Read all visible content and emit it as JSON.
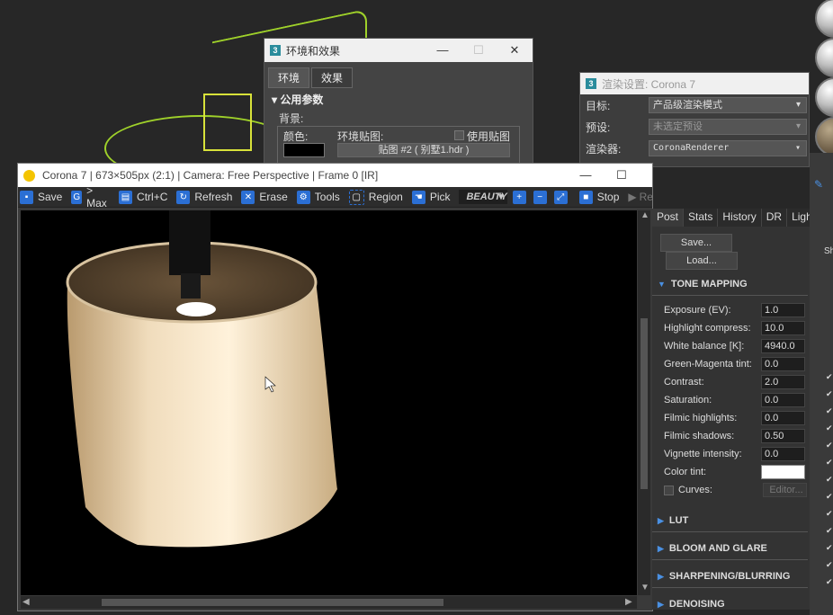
{
  "env_window": {
    "title": "环境和效果",
    "tabs": [
      "环境",
      "效果"
    ],
    "rollout": "公用参数",
    "group_label": "背景:",
    "color_label": "颜色:",
    "map_label": "环境贴图:",
    "use_map_label": "使用贴图",
    "map_button": "贴图 #2 ( 别墅1.hdr )"
  },
  "render_settings": {
    "title": "渲染设置: Corona 7",
    "rows": [
      {
        "label": "目标:",
        "value": "产品级渲染模式"
      },
      {
        "label": "预设:",
        "value": "未选定预设"
      },
      {
        "label": "渲染器:",
        "value": "CoronaRenderer"
      }
    ]
  },
  "vfb": {
    "title": "Corona 7 | 673×505px (2:1) | Camera: Free Perspective | Frame 0 [IR]",
    "toolbar": {
      "save": "Save",
      "max": "> Max",
      "copy": "Ctrl+C",
      "refresh": "Refresh",
      "erase": "Erase",
      "tools": "Tools",
      "region": "Region",
      "pick": "Pick",
      "channel": "BEAUTY",
      "stop": "Stop",
      "render": "Re"
    }
  },
  "post_panel": {
    "tabs": [
      "Post",
      "Stats",
      "History",
      "DR",
      "Ligh"
    ],
    "save_button": "Save...",
    "load_button": "Load...",
    "tone_mapping": "TONE MAPPING",
    "params": [
      {
        "label": "Exposure (EV):",
        "value": "1.0"
      },
      {
        "label": "Highlight compress:",
        "value": "10.0"
      },
      {
        "label": "White balance [K]:",
        "value": "4940.0"
      },
      {
        "label": "Green-Magenta tint:",
        "value": "0.0"
      },
      {
        "label": "Contrast:",
        "value": "2.0"
      },
      {
        "label": "Saturation:",
        "value": "0.0"
      },
      {
        "label": "Filmic highlights:",
        "value": "0.0"
      },
      {
        "label": "Filmic shadows:",
        "value": "0.50"
      },
      {
        "label": "Vignette intensity:",
        "value": "0.0"
      }
    ],
    "color_tint_label": "Color tint:",
    "curves_label": "Curves:",
    "editor_button": "Editor...",
    "sections": [
      "LUT",
      "BLOOM AND GLARE",
      "SHARPENING/BLURRING",
      "DENOISING"
    ]
  }
}
